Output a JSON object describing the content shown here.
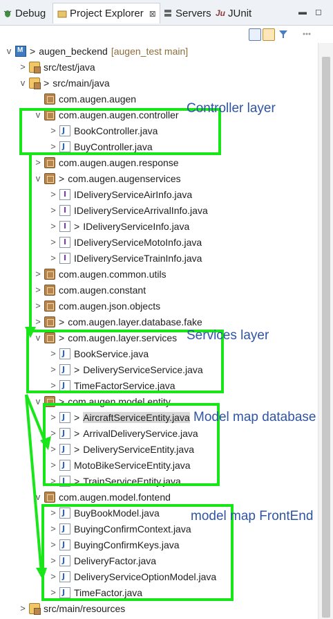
{
  "tabs": [
    {
      "label": "Debug",
      "icon": "bug-icon"
    },
    {
      "label": "Project Explorer",
      "icon": "folder-tree-icon",
      "close": "⊠"
    },
    {
      "label": "Servers",
      "icon": "server-icon"
    },
    {
      "label": "JUnit",
      "icon": "junit-icon",
      "prefix": "Ju"
    }
  ],
  "window_controls": {
    "minimize": "▬",
    "maximize": "◻"
  },
  "toolbar_icons": [
    "collapse-all-icon",
    "link-with-editor-icon",
    "filter-icon",
    "view-menu-icon"
  ],
  "project": {
    "name": "augen_beckend",
    "decoration": "[augen_test main]",
    "prefix": ">"
  },
  "tree": [
    {
      "indent": 0,
      "arrow": "v",
      "icon": "project",
      "prefix": ">",
      "label": "augen_beckend",
      "deco": "[augen_test main]"
    },
    {
      "indent": 1,
      "arrow": ">",
      "icon": "src",
      "label": "src/test/java"
    },
    {
      "indent": 1,
      "arrow": "v",
      "icon": "src",
      "prefix": ">",
      "label": "src/main/java"
    },
    {
      "indent": 2,
      "arrow": "",
      "icon": "pkg",
      "label": "com.augen.augen"
    },
    {
      "indent": 2,
      "arrow": "v",
      "icon": "pkg",
      "label": "com.augen.augen.controller"
    },
    {
      "indent": 3,
      "arrow": ">",
      "icon": "java",
      "label": "BookController.java"
    },
    {
      "indent": 3,
      "arrow": ">",
      "icon": "java",
      "label": "BuyController.java"
    },
    {
      "indent": 2,
      "arrow": ">",
      "icon": "pkg",
      "label": "com.augen.augen.response"
    },
    {
      "indent": 2,
      "arrow": "v",
      "icon": "pkg",
      "prefix": ">",
      "label": "com.augen.augenservices"
    },
    {
      "indent": 3,
      "arrow": ">",
      "icon": "iface",
      "label": "IDeliveryServiceAirInfo.java"
    },
    {
      "indent": 3,
      "arrow": ">",
      "icon": "iface",
      "label": "IDeliveryServiceArrivalInfo.java"
    },
    {
      "indent": 3,
      "arrow": ">",
      "icon": "iface",
      "prefix": ">",
      "label": "IDeliveryServiceInfo.java"
    },
    {
      "indent": 3,
      "arrow": ">",
      "icon": "iface",
      "label": "IDeliveryServiceMotoInfo.java"
    },
    {
      "indent": 3,
      "arrow": ">",
      "icon": "iface",
      "label": "IDeliveryServiceTrainInfo.java"
    },
    {
      "indent": 2,
      "arrow": ">",
      "icon": "pkg",
      "label": "com.augen.common.utils"
    },
    {
      "indent": 2,
      "arrow": ">",
      "icon": "pkg",
      "label": "com.augen.constant"
    },
    {
      "indent": 2,
      "arrow": ">",
      "icon": "pkg",
      "label": "com.augen.json.objects"
    },
    {
      "indent": 2,
      "arrow": ">",
      "icon": "pkg",
      "prefix": ">",
      "label": "com.augen.layer.database.fake"
    },
    {
      "indent": 2,
      "arrow": "v",
      "icon": "pkg",
      "prefix": ">",
      "label": "com.augen.layer.services"
    },
    {
      "indent": 3,
      "arrow": ">",
      "icon": "java",
      "label": "BookService.java"
    },
    {
      "indent": 3,
      "arrow": ">",
      "icon": "java",
      "prefix": ">",
      "label": "DeliveryServiceService.java"
    },
    {
      "indent": 3,
      "arrow": ">",
      "icon": "java",
      "label": "TimeFactorService.java"
    },
    {
      "indent": 2,
      "arrow": "v",
      "icon": "pkg",
      "prefix": ">",
      "label": "com.augen.model.entity"
    },
    {
      "indent": 3,
      "arrow": ">",
      "icon": "java",
      "prefix": ">",
      "label": "AircraftServiceEntity.java",
      "selected": true
    },
    {
      "indent": 3,
      "arrow": ">",
      "icon": "java",
      "prefix": ">",
      "label": "ArrivalDeliveryService.java"
    },
    {
      "indent": 3,
      "arrow": ">",
      "icon": "java",
      "prefix": ">",
      "label": "DeliveryServiceEntity.java"
    },
    {
      "indent": 3,
      "arrow": ">",
      "icon": "java",
      "label": "MotoBikeServiceEntity.java"
    },
    {
      "indent": 3,
      "arrow": ">",
      "icon": "java",
      "prefix": ">",
      "label": "TrainServiceEntity.java"
    },
    {
      "indent": 2,
      "arrow": "v",
      "icon": "pkg",
      "label": "com.augen.model.fontend"
    },
    {
      "indent": 3,
      "arrow": ">",
      "icon": "java",
      "label": "BuyBookModel.java"
    },
    {
      "indent": 3,
      "arrow": ">",
      "icon": "java",
      "label": "BuyingConfirmContext.java"
    },
    {
      "indent": 3,
      "arrow": ">",
      "icon": "java",
      "label": "BuyingConfirmKeys.java"
    },
    {
      "indent": 3,
      "arrow": ">",
      "icon": "java",
      "label": "DeliveryFactor.java"
    },
    {
      "indent": 3,
      "arrow": ">",
      "icon": "java",
      "label": "DeliveryServiceOptionModel.java"
    },
    {
      "indent": 3,
      "arrow": ">",
      "icon": "java",
      "label": "TimeFactor.java"
    },
    {
      "indent": 1,
      "arrow": ">",
      "icon": "src",
      "label": "src/main/resources"
    }
  ],
  "annotations": [
    {
      "label": "Controller layer"
    },
    {
      "label": "Services layer"
    },
    {
      "label": "Model map database"
    },
    {
      "label": "model map FrontEnd"
    }
  ],
  "colors": {
    "annotation_box": "#19e619",
    "annotation_text": "#2e54a3",
    "decoration": "#8a6d3b"
  }
}
